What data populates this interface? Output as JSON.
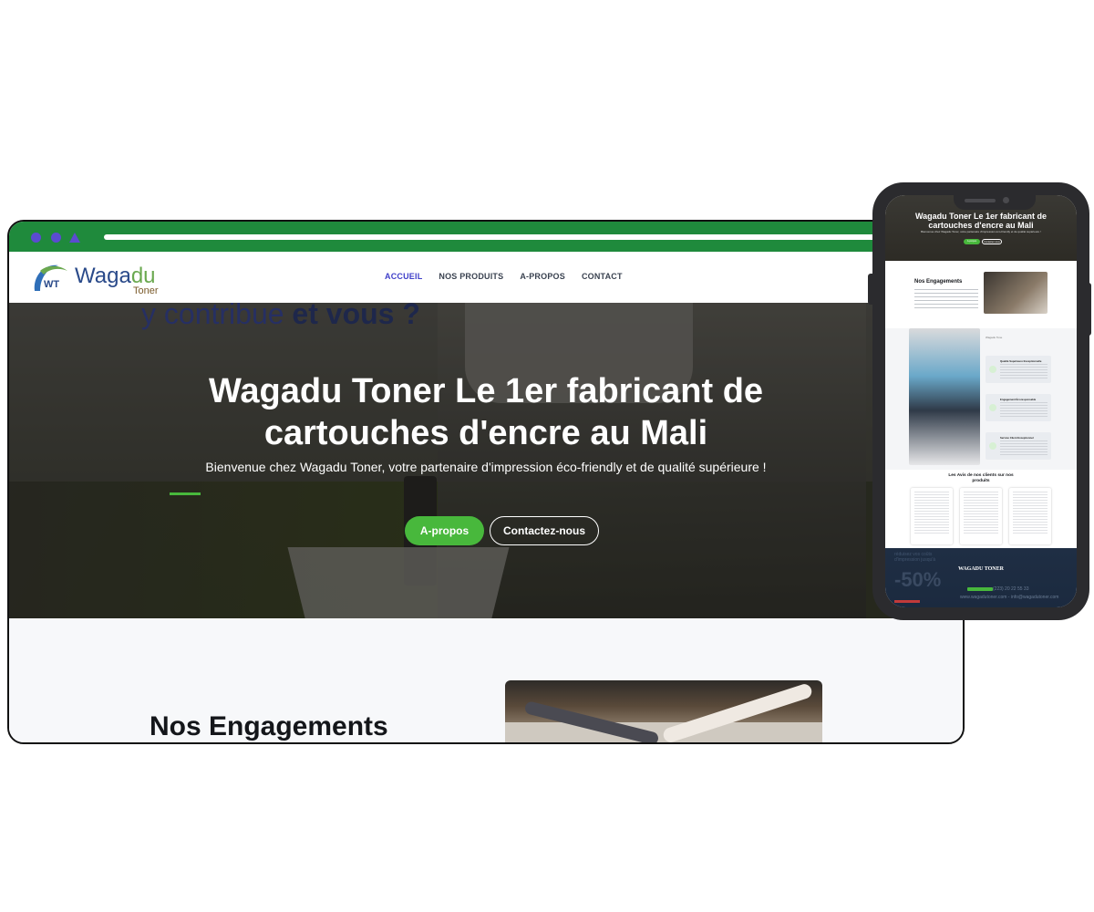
{
  "browser": {
    "nav": {
      "logo_word_main": "Waga",
      "logo_word_accent": "du",
      "logo_sub": "Toner",
      "logo_mark": "WT",
      "links": [
        {
          "label": "ACCUEIL",
          "active": true
        },
        {
          "label": "NOS PRODUITS",
          "active": false
        },
        {
          "label": "A-PROPOS",
          "active": false
        },
        {
          "label": "CONTACT",
          "active": false
        }
      ]
    },
    "hero": {
      "wall_text_plain": "y contribue ",
      "wall_text_bold": "et vous ?",
      "title_line1": "Wagadu Toner Le 1er fabricant de",
      "title_line2": "cartouches d'encre au Mali",
      "tagline": "Bienvenue chez Wagadu Toner, votre partenaire d'impression éco-friendly et de qualité supérieure !",
      "primary_button": "A-propos",
      "secondary_button": "Contactez-nous"
    },
    "section": {
      "heading": "Nos Engagements"
    },
    "colors": {
      "chrome": "#1f8a3c",
      "accent_green": "#48b83c",
      "active_link": "#3f3fc9"
    }
  },
  "phone": {
    "hero": {
      "title_line1": "Wagadu Toner Le 1er fabricant de",
      "title_line2": "cartouches d'encre au Mali",
      "tagline": "Bienvenue chez Wagadu Toner, votre partenaire d'impression éco-friendly et de qualité supérieure !",
      "primary_button": "A-propos",
      "secondary_button": "Contactez-nous"
    },
    "engagements_heading": "Nos Engagements",
    "about_label": "Wagadu Tone",
    "cards": [
      {
        "title": "Qualité Supérieure Exceptionnelle"
      },
      {
        "title": "Engagement Écoresponsable"
      },
      {
        "title": "Service Client Exceptionnel"
      }
    ],
    "reviews_heading_line1": "Les Avis de nos clients sur nos",
    "reviews_heading_line2": "produits",
    "footer": {
      "promo_line1": "réduisez vos coûts",
      "promo_line2": "d'impression jusqu'à",
      "discount": "-50%",
      "brand": "WAGADU TONER",
      "tel": "(223) 20 22 55 33",
      "web": "www.wagadutoner.com - info@wagadutoner.com"
    }
  }
}
